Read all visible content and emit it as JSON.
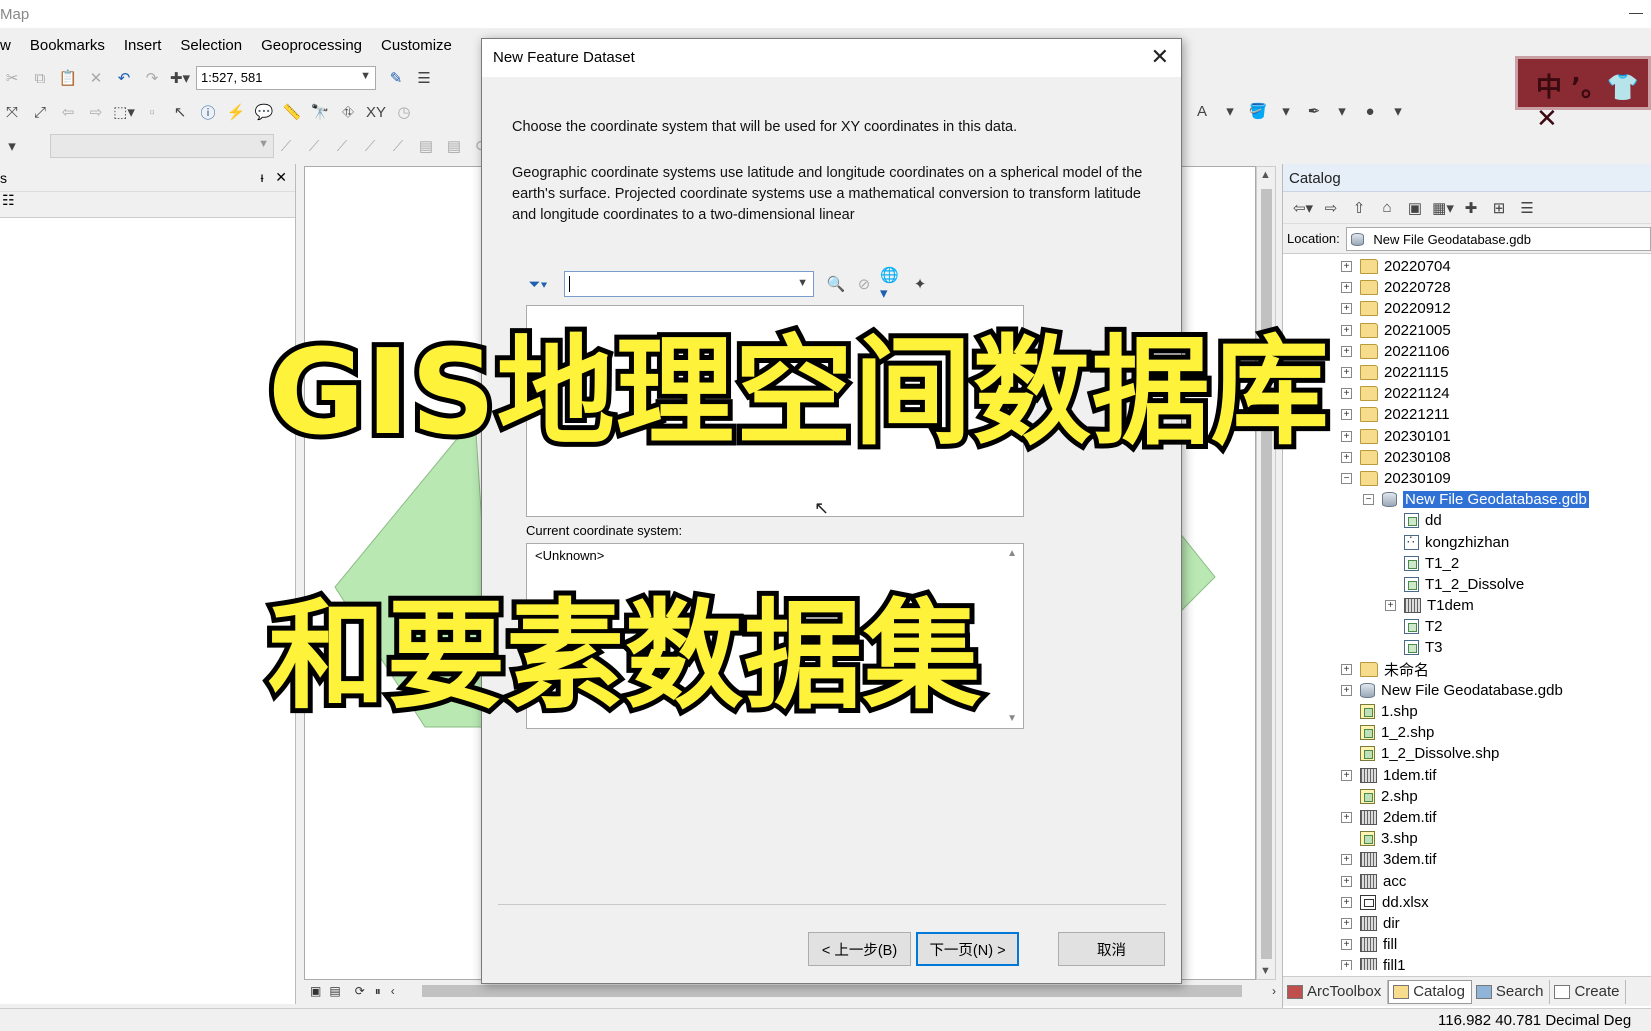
{
  "window": {
    "title": "Map",
    "minimize": "—"
  },
  "menu": [
    "w",
    "Bookmarks",
    "Insert",
    "Selection",
    "Geoprocessing",
    "Customize"
  ],
  "toolbar": {
    "scale": "1:527, 581"
  },
  "toc": {
    "title": "s",
    "pin": "ᵻ",
    "close": "✕"
  },
  "ime": {
    "text": "中 ʼ。👕 ✕"
  },
  "catalog": {
    "title": "Catalog",
    "location_label": "Location:",
    "location_value": "New File Geodatabase.gdb",
    "tree": [
      {
        "label": "20220704",
        "icon": "folder",
        "expand": "+",
        "indent": 0
      },
      {
        "label": "20220728",
        "icon": "folder",
        "expand": "+",
        "indent": 0
      },
      {
        "label": "20220912",
        "icon": "folder",
        "expand": "+",
        "indent": 0
      },
      {
        "label": "20221005",
        "icon": "folder",
        "expand": "+",
        "indent": 0
      },
      {
        "label": "20221106",
        "icon": "folder",
        "expand": "+",
        "indent": 0
      },
      {
        "label": "20221115",
        "icon": "folder",
        "expand": "+",
        "indent": 0
      },
      {
        "label": "20221124",
        "icon": "folder",
        "expand": "+",
        "indent": 0
      },
      {
        "label": "20221211",
        "icon": "folder",
        "expand": "+",
        "indent": 0
      },
      {
        "label": "20230101",
        "icon": "folder",
        "expand": "+",
        "indent": 0
      },
      {
        "label": "20230108",
        "icon": "folder",
        "expand": "+",
        "indent": 0
      },
      {
        "label": "20230109",
        "icon": "folder",
        "expand": "−",
        "indent": 0
      },
      {
        "label": "New File Geodatabase.gdb",
        "icon": "gdb",
        "expand": "−",
        "indent": 1,
        "selected": true
      },
      {
        "label": "dd",
        "icon": "fc",
        "expand": "",
        "indent": 2
      },
      {
        "label": "kongzhizhan",
        "icon": "pt",
        "expand": "",
        "indent": 2
      },
      {
        "label": "T1_2",
        "icon": "fc",
        "expand": "",
        "indent": 2
      },
      {
        "label": "T1_2_Dissolve",
        "icon": "fc",
        "expand": "",
        "indent": 2
      },
      {
        "label": "T1dem",
        "icon": "ras",
        "expand": "+",
        "indent": 2
      },
      {
        "label": "T2",
        "icon": "fc",
        "expand": "",
        "indent": 2
      },
      {
        "label": "T3",
        "icon": "fc",
        "expand": "",
        "indent": 2
      },
      {
        "label": "未命名",
        "icon": "folder",
        "expand": "+",
        "indent": 0
      },
      {
        "label": "New File Geodatabase.gdb",
        "icon": "gdb",
        "expand": "+",
        "indent": 0
      },
      {
        "label": "1.shp",
        "icon": "shp",
        "expand": "",
        "indent": 0
      },
      {
        "label": "1_2.shp",
        "icon": "shp",
        "expand": "",
        "indent": 0
      },
      {
        "label": "1_2_Dissolve.shp",
        "icon": "shp",
        "expand": "",
        "indent": 0
      },
      {
        "label": "1dem.tif",
        "icon": "ras",
        "expand": "+",
        "indent": 0
      },
      {
        "label": "2.shp",
        "icon": "shp",
        "expand": "",
        "indent": 0
      },
      {
        "label": "2dem.tif",
        "icon": "ras",
        "expand": "+",
        "indent": 0
      },
      {
        "label": "3.shp",
        "icon": "shp",
        "expand": "",
        "indent": 0
      },
      {
        "label": "3dem.tif",
        "icon": "ras",
        "expand": "+",
        "indent": 0
      },
      {
        "label": "acc",
        "icon": "ras",
        "expand": "+",
        "indent": 0
      },
      {
        "label": "dd.xlsx",
        "icon": "tbl",
        "expand": "+",
        "indent": 0
      },
      {
        "label": "dir",
        "icon": "ras",
        "expand": "+",
        "indent": 0
      },
      {
        "label": "fill",
        "icon": "ras",
        "expand": "+",
        "indent": 0
      },
      {
        "label": "fill1",
        "icon": "ras",
        "expand": "+",
        "indent": 0
      }
    ],
    "tabs": [
      "ArcToolbox",
      "Catalog",
      "Search",
      "Create"
    ]
  },
  "status": {
    "coords": "116.982  40.781 Decimal Deg"
  },
  "dialog": {
    "title": "New Feature Dataset",
    "close": "✕",
    "text1": "Choose the coordinate system that will be used for XY coordinates in this data.",
    "text2": "Geographic coordinate systems use latitude and longitude coordinates on a spherical model of the earth's surface. Projected coordinate systems use a mathematical conversion to transform latitude and longitude coordinates to a two-dimensional linear",
    "current_label": "Current coordinate system:",
    "current_value": "<Unknown>",
    "btn_back": "< 上一步(B)",
    "btn_next": "下一页(N) >",
    "btn_cancel": "取消"
  },
  "overlay": {
    "line1": "GIS地理空间数据库",
    "line2": "和要素数据集"
  },
  "colors": {
    "overlay_fill": "#fff23a",
    "overlay_stroke": "#000000",
    "selection": "#3071d6",
    "map_polygon": "#b9e8b3"
  }
}
